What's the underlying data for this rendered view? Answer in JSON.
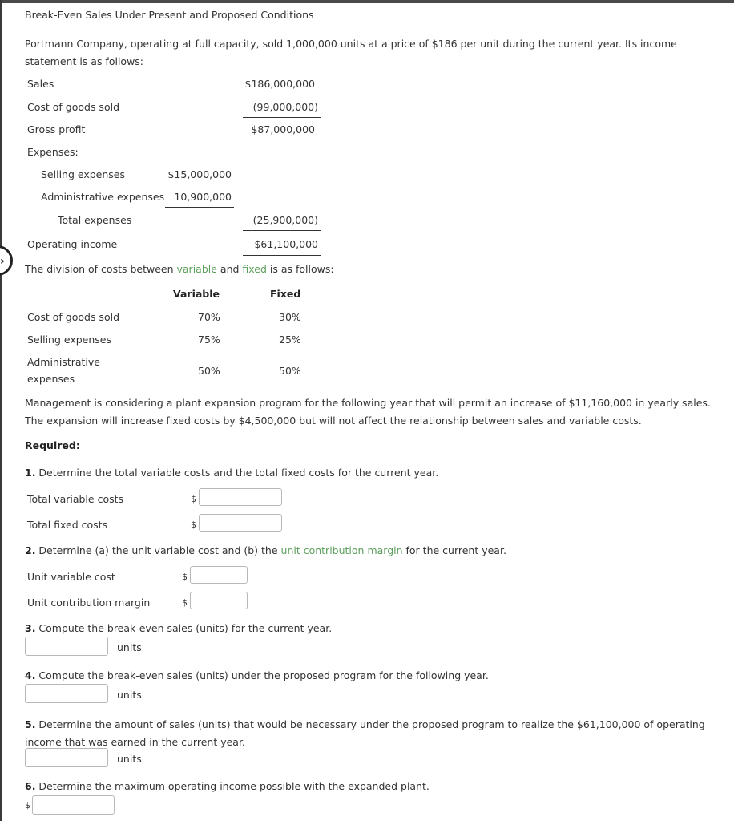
{
  "title": "Break-Even Sales Under Present and Proposed Conditions",
  "intro": "Portmann Company, operating at full capacity, sold 1,000,000 units at a price of $186 per unit during the current year. Its income statement is as follows:",
  "income_statement": {
    "sales_label": "Sales",
    "sales_value": "$186,000,000",
    "cogs_label": "Cost of goods sold",
    "cogs_value": "(99,000,000)",
    "gross_profit_label": "Gross profit",
    "gross_profit_value": "$87,000,000",
    "expenses_label": "Expenses:",
    "selling_label": "Selling expenses",
    "selling_value": "$15,000,000",
    "admin_label": "Administrative expenses",
    "admin_value": "10,900,000",
    "total_expenses_label": "Total expenses",
    "total_expenses_value": "(25,900,000)",
    "operating_income_label": "Operating income",
    "operating_income_value": "$61,100,000"
  },
  "division": {
    "text_before": "The division of costs between ",
    "variable_link": "variable",
    "text_and": " and ",
    "fixed_link": "fixed",
    "text_after": " is as follows:",
    "headers": [
      "",
      "Variable",
      "Fixed"
    ],
    "rows": [
      {
        "label": "Cost of goods sold",
        "variable": "70%",
        "fixed": "30%"
      },
      {
        "label": "Selling expenses",
        "variable": "75%",
        "fixed": "25%"
      },
      {
        "label_line1": "Administrative",
        "label_line2": "expenses",
        "variable": "50%",
        "fixed": "50%"
      }
    ]
  },
  "management_text": "Management is considering a plant expansion program for the following year that will permit an increase of $11,160,000 in yearly sales. The expansion will increase fixed costs by $4,500,000 but will not affect the relationship between sales and variable costs.",
  "required_label": "Required:",
  "questions": {
    "q1": {
      "number": "1.",
      "text": " Determine the total variable costs and the total fixed costs for the current year.",
      "fields": [
        {
          "label": "Total variable costs",
          "prefix": "$",
          "value": ""
        },
        {
          "label": "Total fixed costs",
          "prefix": "$",
          "value": ""
        }
      ]
    },
    "q2": {
      "number": "2.",
      "text_before": " Determine (a) the unit variable cost and (b) the ",
      "link": "unit contribution margin",
      "text_after": " for the current year.",
      "fields": [
        {
          "label": "Unit variable cost",
          "prefix": "$",
          "value": ""
        },
        {
          "label": "Unit contribution margin",
          "prefix": "$",
          "value": ""
        }
      ]
    },
    "q3": {
      "number": "3.",
      "text": " Compute the break-even sales (units) for the current year.",
      "suffix": "units",
      "value": ""
    },
    "q4": {
      "number": "4.",
      "text": " Compute the break-even sales (units) under the proposed program for the following year.",
      "suffix": "units",
      "value": ""
    },
    "q5": {
      "number": "5.",
      "text": " Determine the amount of sales (units) that would be necessary under the proposed program to realize the $61,100,000 of operating income that was earned in the current year.",
      "suffix": "units",
      "value": ""
    },
    "q6": {
      "number": "6.",
      "text": " Determine the maximum operating income possible with the expanded plant.",
      "prefix": "$",
      "value": ""
    }
  },
  "colors": {
    "link_green": "#5c9e5c",
    "text": "#333333"
  }
}
